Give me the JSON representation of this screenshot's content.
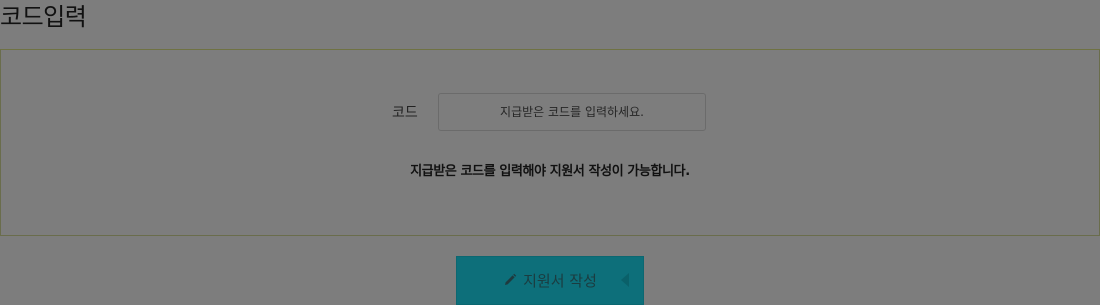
{
  "header": {
    "title": "코드입력"
  },
  "form": {
    "code_label": "코드",
    "code_placeholder": "지급받은 코드를 입력하세요.",
    "code_value": "",
    "notice": "지급받은 코드를 입력해야 지원서 작성이 가능합니다."
  },
  "actions": {
    "write_label": "지원서 작성",
    "write_icon": "pencil-icon"
  },
  "colors": {
    "backdrop": "#7d7d7d",
    "button": "#0d6f7a"
  }
}
